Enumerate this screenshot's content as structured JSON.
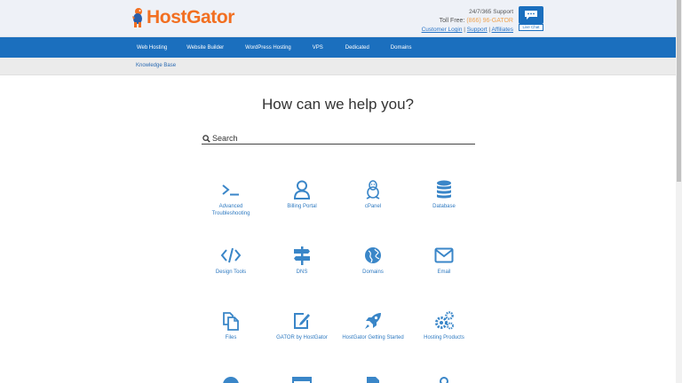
{
  "header": {
    "brand": "HostGator",
    "support_line": "24/7/365 Support",
    "toll_free_label": "Toll Free:",
    "toll_free_number": "(866) 96-GATOR",
    "links": [
      "Customer Login",
      "Support",
      "Affiliates"
    ],
    "chat_label": "Live Chat"
  },
  "nav": {
    "items": [
      "Web Hosting",
      "Website Builder",
      "WordPress Hosting",
      "VPS",
      "Dedicated",
      "Domains"
    ]
  },
  "breadcrumb": "Knowledge Base",
  "hero": {
    "title": "How can we help you?",
    "search_placeholder": "Search"
  },
  "categories": [
    {
      "label": "Advanced Troubleshooting",
      "icon": "terminal-icon"
    },
    {
      "label": "Billing Portal",
      "icon": "user-icon"
    },
    {
      "label": "cPanel",
      "icon": "linux-penguin-icon"
    },
    {
      "label": "Database",
      "icon": "database-icon"
    },
    {
      "label": "Design Tools",
      "icon": "code-icon"
    },
    {
      "label": "DNS",
      "icon": "signpost-icon"
    },
    {
      "label": "Domains",
      "icon": "globe-icon"
    },
    {
      "label": "Email",
      "icon": "envelope-icon"
    },
    {
      "label": "Files",
      "icon": "files-icon"
    },
    {
      "label": "GATOR by HostGator",
      "icon": "edit-icon"
    },
    {
      "label": "HostGator Getting Started",
      "icon": "rocket-icon"
    },
    {
      "label": "Hosting Products",
      "icon": "cogs-icon"
    }
  ],
  "colors": {
    "brand_orange": "#f26f21",
    "nav_blue": "#1b6fbe",
    "link_blue": "#2f7ac1",
    "icon_blue": "#3a86c8"
  }
}
